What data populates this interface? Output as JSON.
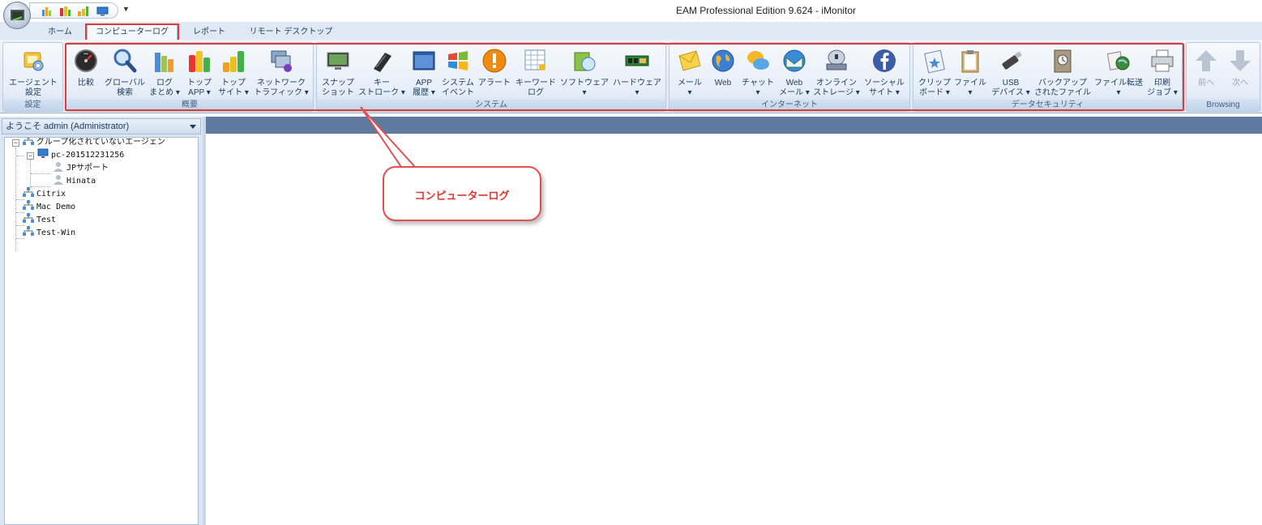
{
  "window": {
    "title": "EAM Professional Edition 9.624 - iMonitor"
  },
  "tabs": [
    "ホーム",
    "コンピューターログ",
    "レポート",
    "リモート デスクトップ"
  ],
  "active_tab_index": 1,
  "ribbon": {
    "groups": [
      {
        "label": "設定",
        "buttons": [
          {
            "line1": "エージェント",
            "line2": "設定",
            "icon": "agent-settings-icon"
          }
        ]
      },
      {
        "label": "概要",
        "buttons": [
          {
            "line1": "比較",
            "line2": "",
            "icon": "compare-gauge-icon"
          },
          {
            "line1": "グローバル",
            "line2": "検索",
            "icon": "magnifier-icon"
          },
          {
            "line1": "ログ",
            "line2": "まとめ ▾",
            "icon": "log-summary-chart-icon"
          },
          {
            "line1": "トップ",
            "line2": "APP ▾",
            "icon": "top-app-chart-icon"
          },
          {
            "line1": "トップ",
            "line2": "サイト ▾",
            "icon": "top-site-chart-icon"
          },
          {
            "line1": "ネットワーク",
            "line2": "トラフィック ▾",
            "icon": "network-traffic-icon"
          }
        ]
      },
      {
        "label": "システム",
        "buttons": [
          {
            "line1": "スナップ",
            "line2": "ショット",
            "icon": "snapshot-icon"
          },
          {
            "line1": "キー",
            "line2": "ストローク ▾",
            "icon": "keyboard-icon"
          },
          {
            "line1": "APP",
            "line2": "履歴 ▾",
            "icon": "app-window-icon"
          },
          {
            "line1": "システム",
            "line2": "イベント",
            "icon": "windows-logo-icon"
          },
          {
            "line1": "アラート",
            "line2": "",
            "icon": "alert-icon"
          },
          {
            "line1": "キーワード",
            "line2": "ログ",
            "icon": "keyword-log-icon"
          },
          {
            "line1": "ソフトウェア",
            "line2": "▾",
            "icon": "software-install-icon"
          },
          {
            "line1": "ハードウェア",
            "line2": "▾",
            "icon": "hardware-board-icon"
          }
        ]
      },
      {
        "label": "インターネット",
        "buttons": [
          {
            "line1": "メール",
            "line2": "▾",
            "icon": "mail-envelope-icon"
          },
          {
            "line1": "Web",
            "line2": "",
            "icon": "globe-icon"
          },
          {
            "line1": "チャット",
            "line2": "▾",
            "icon": "chat-icon"
          },
          {
            "line1": "Web",
            "line2": "メール ▾",
            "icon": "webmail-icon"
          },
          {
            "line1": "オンライン",
            "line2": "ストレージ ▾",
            "icon": "online-storage-icon"
          },
          {
            "line1": "ソーシャル",
            "line2": "サイト ▾",
            "icon": "facebook-icon"
          }
        ]
      },
      {
        "label": "データセキュリティ",
        "buttons": [
          {
            "line1": "クリップ",
            "line2": "ボード ▾",
            "icon": "clipboard-star-icon"
          },
          {
            "line1": "ファイル",
            "line2": "▾",
            "icon": "file-clipboard-icon"
          },
          {
            "line1": "USB",
            "line2": "デバイス ▾",
            "icon": "usb-drive-icon"
          },
          {
            "line1": "バックアップ",
            "line2": "されたファイル",
            "icon": "backup-file-icon"
          },
          {
            "line1": "ファイル転送",
            "line2": "▾",
            "icon": "file-transfer-icon"
          },
          {
            "line1": "印刷",
            "line2": "ジョブ ▾",
            "icon": "printer-icon"
          }
        ]
      },
      {
        "label": "Browsing",
        "buttons": [
          {
            "line1": "前へ",
            "line2": "",
            "icon": "arrow-up-icon"
          },
          {
            "line1": "次へ",
            "line2": "",
            "icon": "arrow-down-icon"
          }
        ]
      }
    ]
  },
  "left_pane": {
    "header": "ようこそ admin (Administrator)",
    "tree": [
      {
        "label": "グループ化されていないエージェン",
        "icon": "group-network-icon"
      },
      {
        "label": "pc-201512231256",
        "icon": "computer-icon"
      },
      {
        "label": "JPサポート",
        "icon": "user-icon"
      },
      {
        "label": "Hinata",
        "icon": "user-icon"
      },
      {
        "label": "Citrix",
        "icon": "group-network-icon"
      },
      {
        "label": "Mac Demo",
        "icon": "group-network-icon"
      },
      {
        "label": "Test",
        "icon": "group-network-icon"
      },
      {
        "label": "Test-Win",
        "icon": "group-network-icon"
      }
    ]
  },
  "callout": {
    "text": "コンピューターログ"
  },
  "colors": {
    "highlight": "#e03a3a",
    "ribbon_bg": "#dbe6f3",
    "main_header": "#5f7aa0"
  }
}
